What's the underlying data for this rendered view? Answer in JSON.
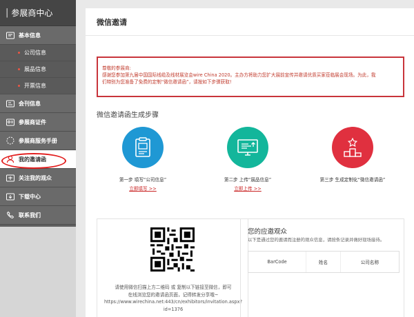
{
  "sidebar": {
    "title": "参展商中心",
    "items": [
      {
        "label": "基本信息",
        "icon": "id-card-icon"
      },
      {
        "label": "会刊信息",
        "icon": "catalog-icon"
      },
      {
        "label": "参展商证件",
        "icon": "badge-icon"
      },
      {
        "label": "参展商服务手册",
        "icon": "manual-icon"
      },
      {
        "label": "我的邀请函",
        "icon": "user-icon"
      },
      {
        "label": "关注我的观众",
        "icon": "audience-icon"
      },
      {
        "label": "下载中心",
        "icon": "download-icon"
      },
      {
        "label": "联系我们",
        "icon": "phone-icon"
      }
    ],
    "sub_items": [
      "公司信息",
      "展品信息",
      "开票信息"
    ],
    "accent_color": "#e21d1d"
  },
  "main": {
    "title": "微信邀请",
    "notice": {
      "greeting": "尊敬的参展商:",
      "line1": "感谢您参加第九届中国国际线缆及线材展览会wire China 2020。主办方将助力您扩大展前宣传并邀请优质买家莅临展会现场。为此，我",
      "line2": "们特别为您准备了免费的定制“微信邀请函”，请按如下步骤获取!"
    },
    "steps_title": "微信邀请函生成步骤",
    "steps": [
      {
        "label": "第一步 填写“公司信息”",
        "link": "立即填写 >>",
        "color": "#1f98d4"
      },
      {
        "label": "第二步 上传“展品信息”",
        "link": "立即上传 >>",
        "color": "#13b69b"
      },
      {
        "label": "第三步 生成定制化“微信邀请函”",
        "link": "",
        "color": "#e0303f"
      }
    ],
    "qr_text": {
      "line1": "请使用微信扫描上方二维码 或 复制以下链接至微信，即可",
      "line2": "在线浏览您的邀请函页面，记得转发分享哦~",
      "line3": "https://www.wirechina.net:443/cn/exhibitors/invitation.aspx?",
      "line4": "id=1376"
    },
    "audience": {
      "title": "您的应邀观众",
      "desc": "以下是通过您的邀请而注册的观众信息，请按条记录并做好现场接待。",
      "columns": [
        "BarCode",
        "姓名",
        "公司名称"
      ]
    }
  }
}
